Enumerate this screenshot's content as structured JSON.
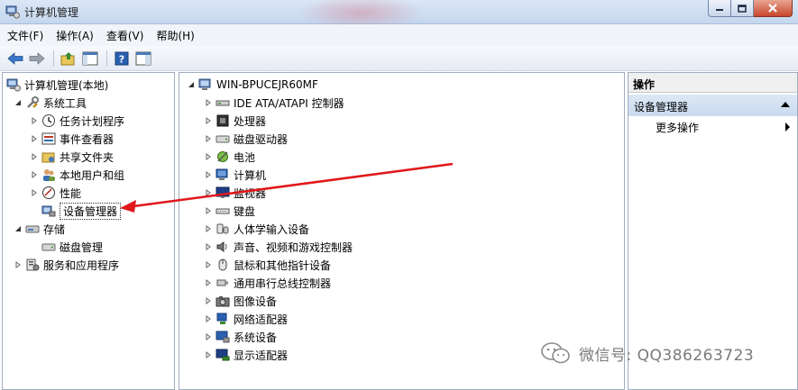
{
  "window": {
    "title": "计算机管理"
  },
  "menubar": {
    "items": [
      "文件(F)",
      "操作(A)",
      "查看(V)",
      "帮助(H)"
    ]
  },
  "left_tree": {
    "root": "计算机管理(本地)",
    "system_tools": "系统工具",
    "task_scheduler": "任务计划程序",
    "event_viewer": "事件查看器",
    "shared_folders": "共享文件夹",
    "local_users": "本地用户和组",
    "performance": "性能",
    "device_manager": "设备管理器",
    "storage": "存储",
    "disk_management": "磁盘管理",
    "services_apps": "服务和应用程序"
  },
  "device_tree": {
    "computer_name": "WIN-BPUCEJR60MF",
    "categories": [
      "IDE ATA/ATAPI 控制器",
      "处理器",
      "磁盘驱动器",
      "电池",
      "计算机",
      "监视器",
      "键盘",
      "人体学输入设备",
      "声音、视频和游戏控制器",
      "鼠标和其他指针设备",
      "通用串行总线控制器",
      "图像设备",
      "网络适配器",
      "系统设备",
      "显示适配器"
    ]
  },
  "actions_pane": {
    "header": "操作",
    "group_title": "设备管理器",
    "more_actions": "更多操作"
  },
  "watermark": {
    "text": "微信号: QQ386263723"
  },
  "colors": {
    "annotation_arrow": "#e0181b",
    "selection_border": "#333333"
  }
}
